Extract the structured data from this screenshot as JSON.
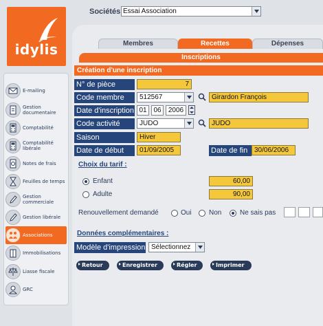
{
  "brand": {
    "name": "idylis",
    "color": "#f26a21"
  },
  "colors": {
    "accent": "#f26a21",
    "label_bg": "#26457a",
    "field_bg": "#f5c83c",
    "button_bg": "#2a3b5a"
  },
  "top": {
    "societes_label": "Sociétés",
    "societes_value": "Essai Association"
  },
  "sidebar": {
    "items": [
      {
        "label": "E-mailing",
        "icon": "mail-icon",
        "active": false
      },
      {
        "label": "Gestion documentaire",
        "icon": "document-icon",
        "active": false
      },
      {
        "label": "Comptabilité",
        "icon": "calculator-icon",
        "active": false
      },
      {
        "label": "Comptabilité libérale",
        "icon": "calculator-icon",
        "active": false
      },
      {
        "label": "Notes de frais",
        "icon": "receipt-icon",
        "active": false
      },
      {
        "label": "Feuilles de temps",
        "icon": "hourglass-icon",
        "active": false
      },
      {
        "label": "Gestion commerciale",
        "icon": "pen-icon",
        "active": false
      },
      {
        "label": "Gestion libérale",
        "icon": "pen-icon",
        "active": false
      },
      {
        "label": "Associations",
        "icon": "people-icon",
        "active": true
      },
      {
        "label": "Immobilisations",
        "icon": "building-icon",
        "active": false
      },
      {
        "label": "Liasse fiscale",
        "icon": "scale-icon",
        "active": false
      },
      {
        "label": "GRC",
        "icon": "contacts-icon",
        "active": false
      }
    ]
  },
  "tabs": [
    {
      "label": "Membres",
      "active": false
    },
    {
      "label": "Recettes",
      "active": true
    },
    {
      "label": "Dépenses",
      "active": false
    }
  ],
  "subtitle": "Inscriptions",
  "section_title": "Création d'une inscription",
  "form": {
    "piece_label": "N° de pièce",
    "piece_value": "7",
    "membre_label": "Code membre",
    "membre_code": "512567",
    "membre_name": "Girardon François",
    "date_label": "Date d'inscription",
    "date_day": "01",
    "date_month": "06",
    "date_year": "2006",
    "activite_label": "Code activité",
    "activite_code": "JUDO",
    "activite_name": "JUDO",
    "saison_label": "Saison",
    "saison_value": "Hiver",
    "debut_label": "Date de début",
    "debut_value": "01/09/2005",
    "fin_label": "Date de fin",
    "fin_value": "30/06/2006"
  },
  "tarif": {
    "heading": "Choix du tarif :",
    "options": [
      {
        "label": "Enfant",
        "value": "60,00",
        "selected": true
      },
      {
        "label": "Adulte",
        "value": "90,00",
        "selected": false
      }
    ]
  },
  "renouvellement": {
    "label": "Renouvellement demandé",
    "options": [
      {
        "label": "Oui",
        "selected": false
      },
      {
        "label": "Non",
        "selected": false
      },
      {
        "label": "Ne sais pas",
        "selected": true
      }
    ]
  },
  "complement": {
    "heading": "Données complémentaires :",
    "modele_label": "Modèle d'impression",
    "modele_value": "Sélectionnez"
  },
  "buttons": {
    "retour": "Retour",
    "enregistrer": "Enregistrer",
    "regler": "Régler",
    "imprimer": "Imprimer"
  }
}
